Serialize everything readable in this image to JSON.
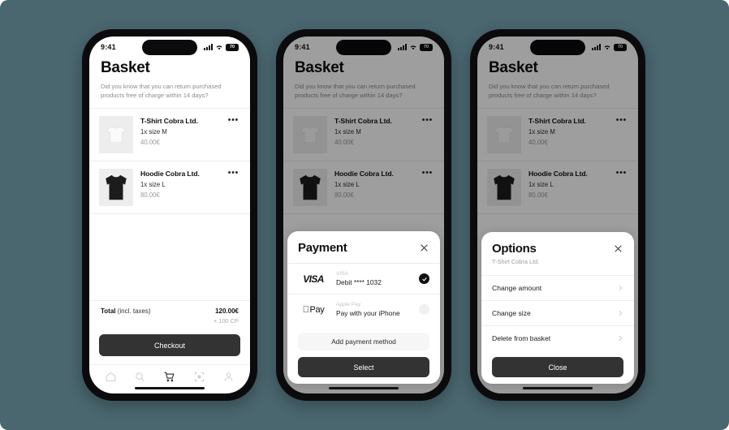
{
  "canvas": {
    "background": "#4a666f"
  },
  "status_bar": {
    "time": "9:41",
    "battery": "70",
    "wifi_icon": "wifi-icon",
    "signal_icon": "cellular-signal-icon"
  },
  "basket": {
    "title": "Basket",
    "subtitle": "Did you know that you can return purchased products free of charge within 14 days?",
    "items": [
      {
        "name": "T-Shirt Cobra Ltd.",
        "variant": "1x size M",
        "price": "40.00€",
        "menu": "•••",
        "thumb": "tshirt-thumbnail"
      },
      {
        "name": "Hoodie Cobra Ltd.",
        "variant": "1x size L",
        "price": "80.00€",
        "menu": "•••",
        "thumb": "hoodie-thumbnail"
      }
    ],
    "total_label_bold": "Total",
    "total_label_rest": " (incl. taxes)",
    "total_amount": "120.00€",
    "total_bonus": "+ 100 CP",
    "checkout_label": "Checkout",
    "tabs": [
      {
        "icon": "home-icon",
        "active": false
      },
      {
        "icon": "search-icon",
        "active": false
      },
      {
        "icon": "cart-icon",
        "active": true
      },
      {
        "icon": "scan-icon",
        "active": false
      },
      {
        "icon": "profile-icon",
        "active": false
      }
    ]
  },
  "payment_sheet": {
    "title": "Payment",
    "close_icon": "close-icon",
    "methods": [
      {
        "logo": "visa-logo",
        "logo_text": "VISA",
        "kind": "VISA",
        "desc": "Debit **** 1032",
        "selected": true
      },
      {
        "logo": "apple-pay-logo",
        "logo_text": "Pay",
        "kind": "Apple Pay",
        "desc": "Pay with your iPhone",
        "selected": false
      }
    ],
    "add_method_label": "Add payment method",
    "primary_label": "Select"
  },
  "options_sheet": {
    "title": "Options",
    "subtitle": "T-Shirt Cobra Ltd.",
    "close_icon": "close-icon",
    "rows": [
      {
        "label": "Change amount",
        "chevron": "chevron-right-icon"
      },
      {
        "label": "Change size",
        "chevron": "chevron-right-icon"
      },
      {
        "label": "Delete from basket",
        "chevron": "chevron-right-icon"
      }
    ],
    "primary_label": "Close"
  }
}
